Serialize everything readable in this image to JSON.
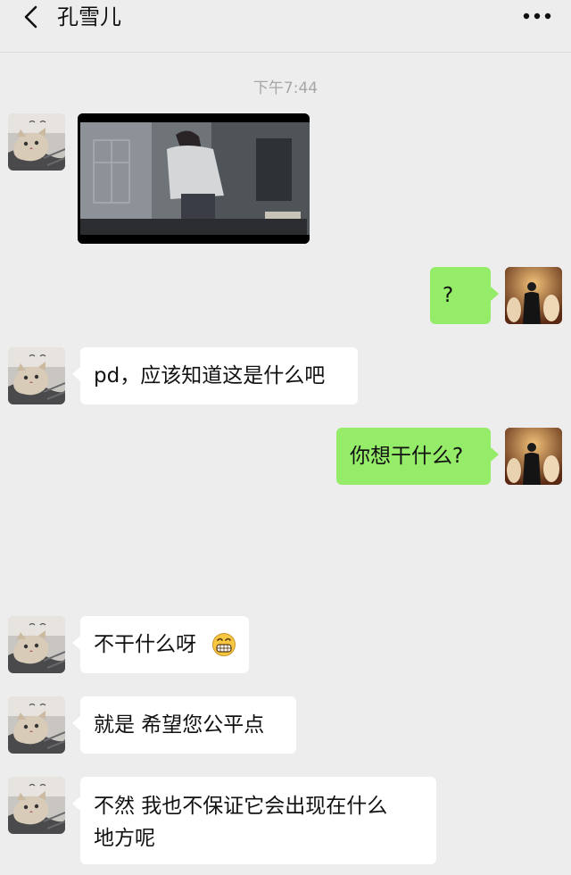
{
  "header": {
    "title": "孔雪儿",
    "back_icon": "chevron-left-icon",
    "more_icon": "more-dots-icon"
  },
  "timestamp": "下午7:44",
  "messages": [
    {
      "from": "contact",
      "type": "video"
    },
    {
      "from": "me",
      "text": "?"
    },
    {
      "from": "contact",
      "text": "pd，应该知道这是什么吧"
    },
    {
      "from": "me",
      "text": "你想干什么?"
    },
    {
      "from": "contact",
      "text": "不干什么呀",
      "emoji": "grin-emoji-icon"
    },
    {
      "from": "contact",
      "text": "就是 希望您公平点"
    },
    {
      "from": "contact",
      "line1": "不然 我也不保证它会出现在什么",
      "line2": "地方呢"
    }
  ],
  "colors": {
    "background": "#ededed",
    "incoming_bubble": "#ffffff",
    "outgoing_bubble": "#95ec69",
    "timestamp": "#a6a6a6"
  }
}
